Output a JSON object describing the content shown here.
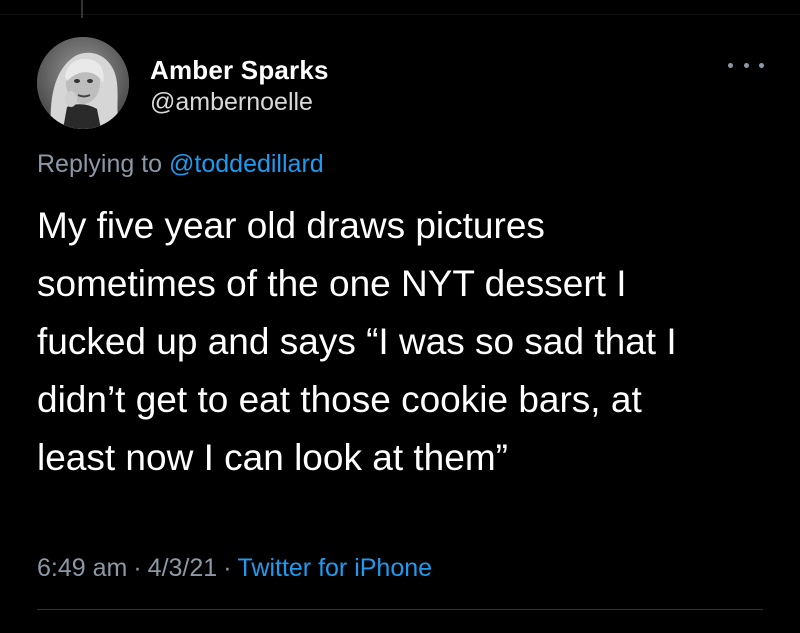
{
  "tweet": {
    "author_name": "Amber Sparks",
    "author_handle": "@ambernoelle",
    "avatar_icon": "user-avatar-photo",
    "more_icon": "more-horizontal-icon",
    "replying_prefix": "Replying to",
    "replying_to": "@toddedillard",
    "text_lines": [
      "My five year old draws pictures",
      "sometimes of the one NYT dessert I",
      "fucked up and says “I was so sad that I",
      "didn’t get to eat those cookie bars, at",
      "least now I can look at them”"
    ],
    "time": "6:49 am",
    "date": "4/3/21",
    "separator": "·",
    "source": "Twitter for iPhone"
  },
  "colors": {
    "background": "#000000",
    "text_primary": "#ffffff",
    "text_secondary": "#8b98a5",
    "link": "#1d9bf0",
    "divider": "#2f3336"
  }
}
